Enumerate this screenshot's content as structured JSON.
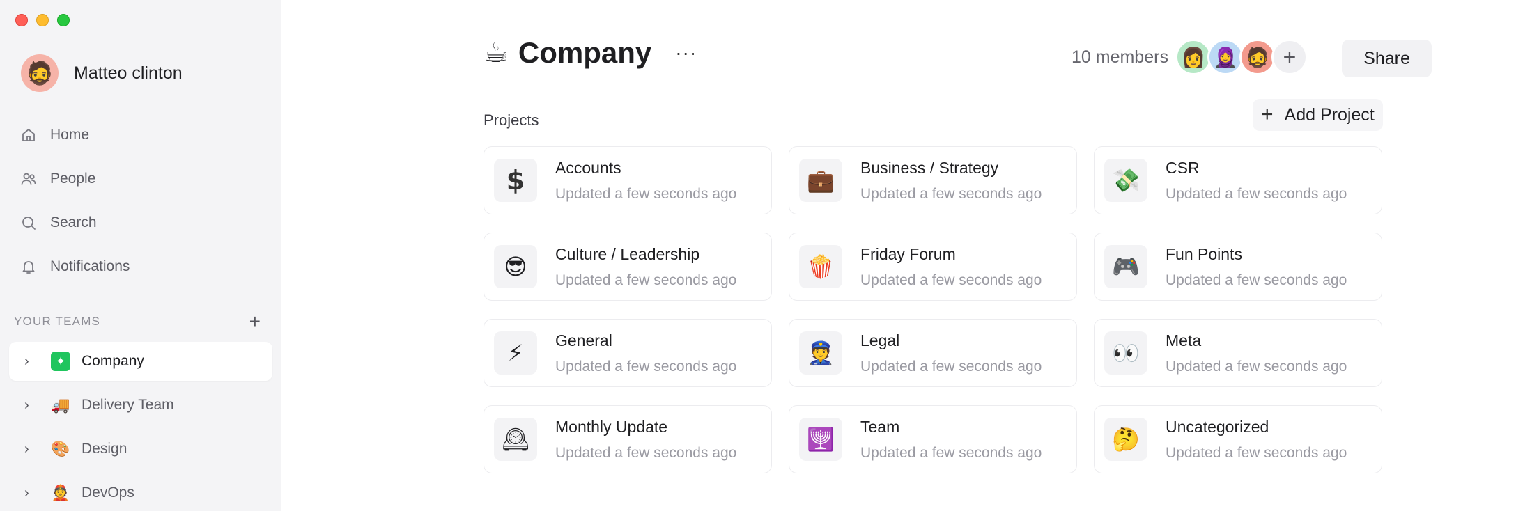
{
  "user": {
    "name": "Matteo clinton",
    "avatar_emoji": "🧔"
  },
  "nav": [
    {
      "label": "Home",
      "icon": "home-icon"
    },
    {
      "label": "People",
      "icon": "people-icon"
    },
    {
      "label": "Search",
      "icon": "search-icon"
    },
    {
      "label": "Notifications",
      "icon": "bell-icon"
    }
  ],
  "teams": {
    "header": "YOUR TEAMS",
    "add": "+",
    "items": [
      {
        "label": "Company",
        "emoji": "✦",
        "active": true
      },
      {
        "label": "Delivery Team",
        "emoji": "🚚"
      },
      {
        "label": "Design",
        "emoji": "🎨"
      },
      {
        "label": "DevOps",
        "emoji": "👲"
      }
    ]
  },
  "header": {
    "emoji": "☕",
    "title": "Company",
    "more": "···"
  },
  "members": {
    "count": "10 members",
    "avatars": [
      "👩",
      "🧕",
      "🧔"
    ],
    "add": "+"
  },
  "share_label": "Share",
  "projects": {
    "label": "Projects",
    "add_label": "Add Project",
    "items": [
      {
        "title": "Accounts",
        "subtitle": "Updated a few seconds ago",
        "icon": "$"
      },
      {
        "title": "Business / Strategy",
        "subtitle": "Updated a few seconds ago",
        "icon": "💼"
      },
      {
        "title": "CSR",
        "subtitle": "Updated a few seconds ago",
        "icon": "💸"
      },
      {
        "title": "Culture / Leadership",
        "subtitle": "Updated a few seconds ago",
        "icon": "😎"
      },
      {
        "title": "Friday Forum",
        "subtitle": "Updated a few seconds ago",
        "icon": "🍿"
      },
      {
        "title": "Fun Points",
        "subtitle": "Updated a few seconds ago",
        "icon": "🎮"
      },
      {
        "title": "General",
        "subtitle": "Updated a few seconds ago",
        "icon": "⚡"
      },
      {
        "title": "Legal",
        "subtitle": "Updated a few seconds ago",
        "icon": "👮"
      },
      {
        "title": "Meta",
        "subtitle": "Updated a few seconds ago",
        "icon": "👀"
      },
      {
        "title": "Monthly Update",
        "subtitle": "Updated a few seconds ago",
        "icon": "🕰"
      },
      {
        "title": "Team",
        "subtitle": "Updated a few seconds ago",
        "icon": "🕎"
      },
      {
        "title": "Uncategorized",
        "subtitle": "Updated a few seconds ago",
        "icon": "🤔"
      }
    ]
  }
}
